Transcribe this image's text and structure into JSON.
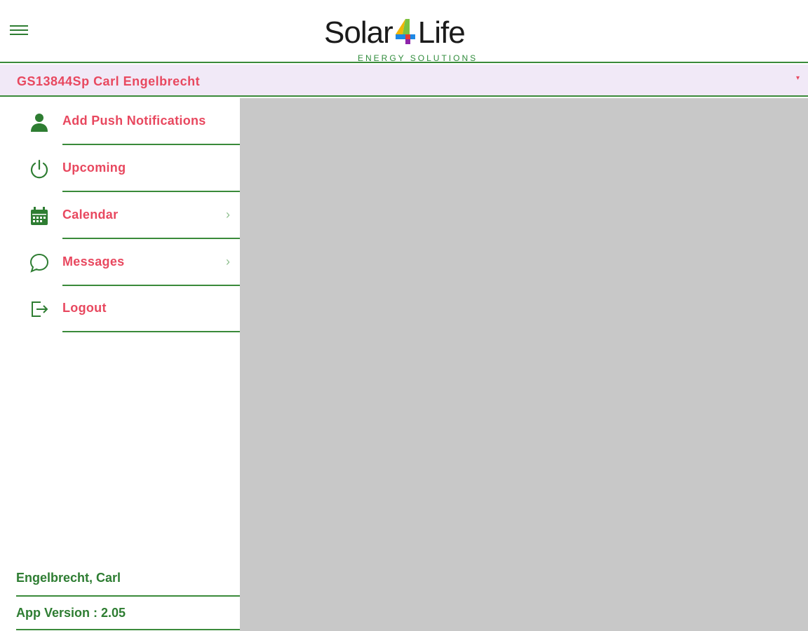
{
  "header": {
    "logo_text_left": "Solar",
    "logo_text_right": "Life",
    "logo_subtitle": "ENERGY SOLUTIONS"
  },
  "account": {
    "name": "GS13844Sp Carl Engelbrecht"
  },
  "sidebar": {
    "items": [
      {
        "label": "Add Push Notifications",
        "icon": "person-icon",
        "has_chevron": false
      },
      {
        "label": "Upcoming",
        "icon": "power-icon",
        "has_chevron": false
      },
      {
        "label": "Calendar",
        "icon": "calendar-icon",
        "has_chevron": true
      },
      {
        "label": "Messages",
        "icon": "chat-bubble-icon",
        "has_chevron": true
      },
      {
        "label": "Logout",
        "icon": "logout-icon",
        "has_chevron": false
      }
    ],
    "footer_user": "Engelbrecht, Carl",
    "footer_version": "App Version : 2.05"
  },
  "colors": {
    "accent_green": "#2e7d32",
    "label_red": "#e8485f",
    "account_bar_bg": "#f1e9f7",
    "content_bg": "#c8c8c8"
  }
}
